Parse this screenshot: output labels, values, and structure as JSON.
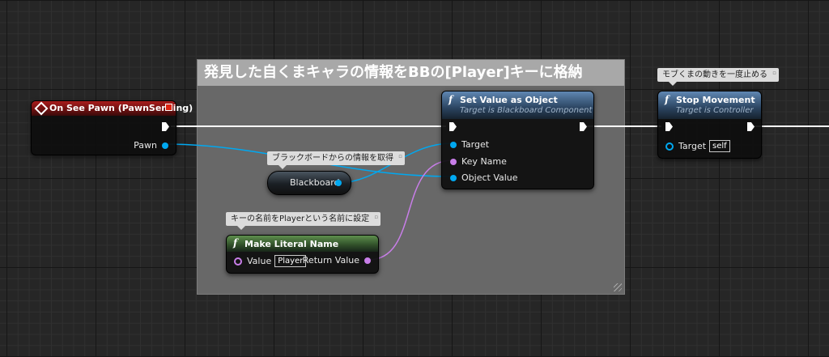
{
  "comment_box": {
    "title": "発見した自くまキャラの情報をBBの[Player]キーに格納"
  },
  "event_node": {
    "title": "On See Pawn (PawnSensing)",
    "out_pin": "Pawn"
  },
  "set_value_node": {
    "title": "Set Value as Object",
    "subtitle": "Target is Blackboard Component",
    "pins": {
      "target": "Target",
      "key_name": "Key Name",
      "object_value": "Object Value"
    }
  },
  "stop_movement_node": {
    "title": "Stop Movement",
    "subtitle": "Target is Controller",
    "target_label": "Target",
    "target_value": "self"
  },
  "blackboard_node": {
    "label": "Blackboard"
  },
  "make_literal_node": {
    "title": "Make Literal Name",
    "value_label": "Value",
    "value": "Player",
    "return_label": "Return Value"
  },
  "comments": {
    "blackboard": "ブラックボードからの情報を取得",
    "make_literal": "キーの名前をPlayerという名前に設定",
    "stop_movement": "モブくまの動きを一度止める"
  },
  "colors": {
    "exec": "#ffffff",
    "object": "#00a8f0",
    "name": "#c87ee8"
  }
}
